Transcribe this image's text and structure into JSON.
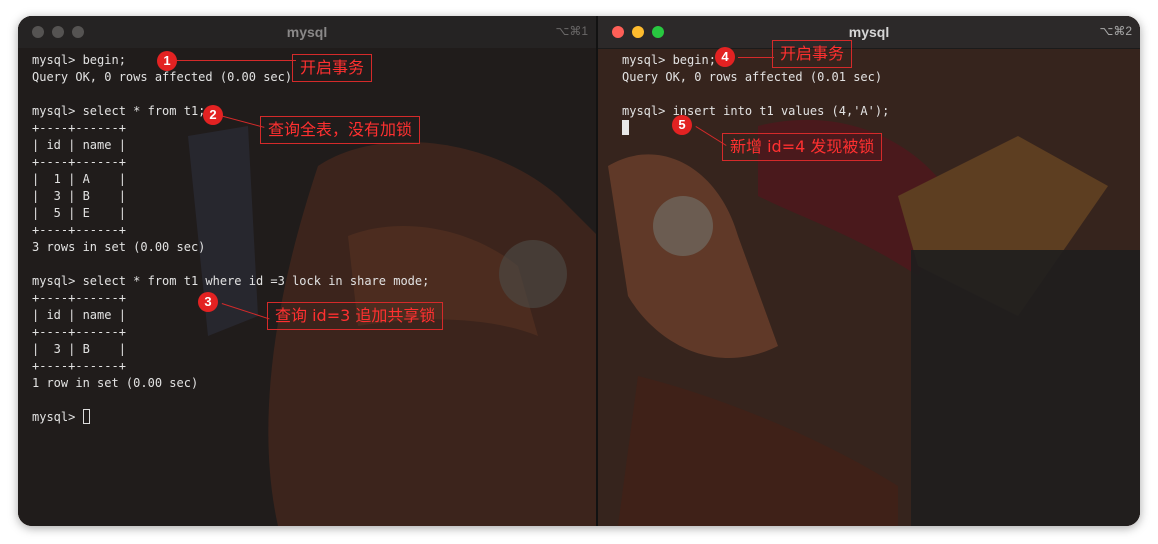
{
  "left_window": {
    "title": "mysql",
    "shortcut": "⌥⌘1",
    "lines": [
      "mysql> begin;",
      "Query OK, 0 rows affected (0.00 sec)",
      "",
      "mysql> select * from t1;",
      "+----+------+",
      "| id | name |",
      "+----+------+",
      "|  1 | A    |",
      "|  3 | B    |",
      "|  5 | E    |",
      "+----+------+",
      "3 rows in set (0.00 sec)",
      "",
      "mysql> select * from t1 where id =3 lock in share mode;",
      "+----+------+",
      "| id | name |",
      "+----+------+",
      "|  3 | B    |",
      "+----+------+",
      "1 row in set (0.00 sec)",
      ""
    ],
    "prompt": "mysql> "
  },
  "right_window": {
    "title": "mysql",
    "shortcut": "⌥⌘2",
    "lines": [
      "mysql> begin;",
      "Query OK, 0 rows affected (0.01 sec)",
      "",
      "mysql> insert into t1 values (4,'A');"
    ]
  },
  "annotations": [
    {
      "number": "1",
      "text": "开启事务"
    },
    {
      "number": "2",
      "text": "查询全表，没有加锁"
    },
    {
      "number": "3",
      "text": "查询 id=3 追加共享锁"
    },
    {
      "number": "4",
      "text": "开启事务"
    },
    {
      "number": "5",
      "text": "新增 id=4 发现被锁"
    }
  ],
  "colors": {
    "annotation_red": "#e32222",
    "terminal_text": "#e2e2e2"
  }
}
